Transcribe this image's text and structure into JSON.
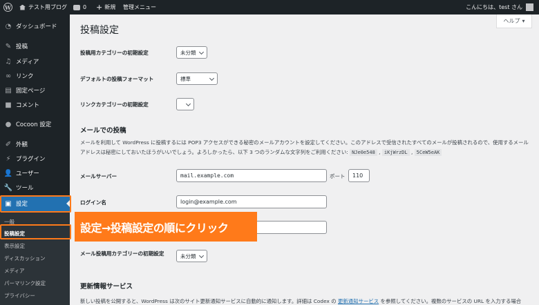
{
  "adminbar": {
    "site_name": "テスト用ブログ",
    "comment_count": "0",
    "new_label": "新規",
    "manage_menu": "管理メニュー",
    "greeting": "こんにちは、test さん"
  },
  "sidebar": {
    "items": [
      {
        "label": "ダッシュボード",
        "icon": "dashboard-icon"
      },
      {
        "label": "投稿",
        "icon": "pin-icon"
      },
      {
        "label": "メディア",
        "icon": "media-icon"
      },
      {
        "label": "リンク",
        "icon": "link-icon"
      },
      {
        "label": "固定ページ",
        "icon": "page-icon"
      },
      {
        "label": "コメント",
        "icon": "comment-icon"
      },
      {
        "label": "Cocoon 設定",
        "icon": "cocoon-icon"
      },
      {
        "label": "外観",
        "icon": "brush-icon"
      },
      {
        "label": "プラグイン",
        "icon": "plugin-icon"
      },
      {
        "label": "ユーザー",
        "icon": "user-icon"
      },
      {
        "label": "ツール",
        "icon": "wrench-icon"
      },
      {
        "label": "設定",
        "icon": "settings-icon"
      }
    ],
    "submenu": [
      "一般",
      "投稿設定",
      "表示設定",
      "ディスカッション",
      "メディア",
      "パーマリンク設定",
      "プライバシー"
    ]
  },
  "help_label": "ヘルプ",
  "page_title": "投稿設定",
  "fields": {
    "default_category": {
      "label": "投稿用カテゴリーの初期設定",
      "value": "未分類"
    },
    "default_format": {
      "label": "デフォルトの投稿フォーマット",
      "value": "標準"
    },
    "link_category": {
      "label": "リンクカテゴリーの初期設定",
      "value": ""
    }
  },
  "email_section": {
    "title": "メールでの投稿",
    "desc_1": "メールを利用して WordPress に投稿するには POP3 アクセスができる秘密のメールアカウントを設定してください。このアドレスで受信されたすべてのメールが投稿されるので、使用するメールアドレスは秘密にしておいたほうがいいでしょう。よろしかったら、以下 3 つのランダムな文字列をご利用ください:",
    "codes": [
      "NJe0e548",
      "iKjWrzDL",
      "5CeW5eAK"
    ],
    "sep": ","
  },
  "mail_server": {
    "label": "メールサーバー",
    "value": "mail.example.com",
    "port_label": "ポート",
    "port_value": "110"
  },
  "login_name": {
    "label": "ログイン名",
    "value": "login@example.com"
  },
  "mail_category": {
    "label": "メール投稿用カテゴリーの初期設定",
    "value": "未分類"
  },
  "update_section": {
    "title": "更新情報サービス",
    "desc_pre": "新しい投稿を公開すると、WordPress は次のサイト更新通知サービスに自動的に通知します。詳細は Codex の",
    "link": "更新通知サービス",
    "desc_post": "を参照してください。複数のサービスの URL を入力する場合"
  },
  "callout": "設定→投稿設定の順にクリック",
  "colors": {
    "accent": "#2271b1",
    "highlight": "#ff7a1a",
    "sidebar_bg": "#1d2327"
  }
}
